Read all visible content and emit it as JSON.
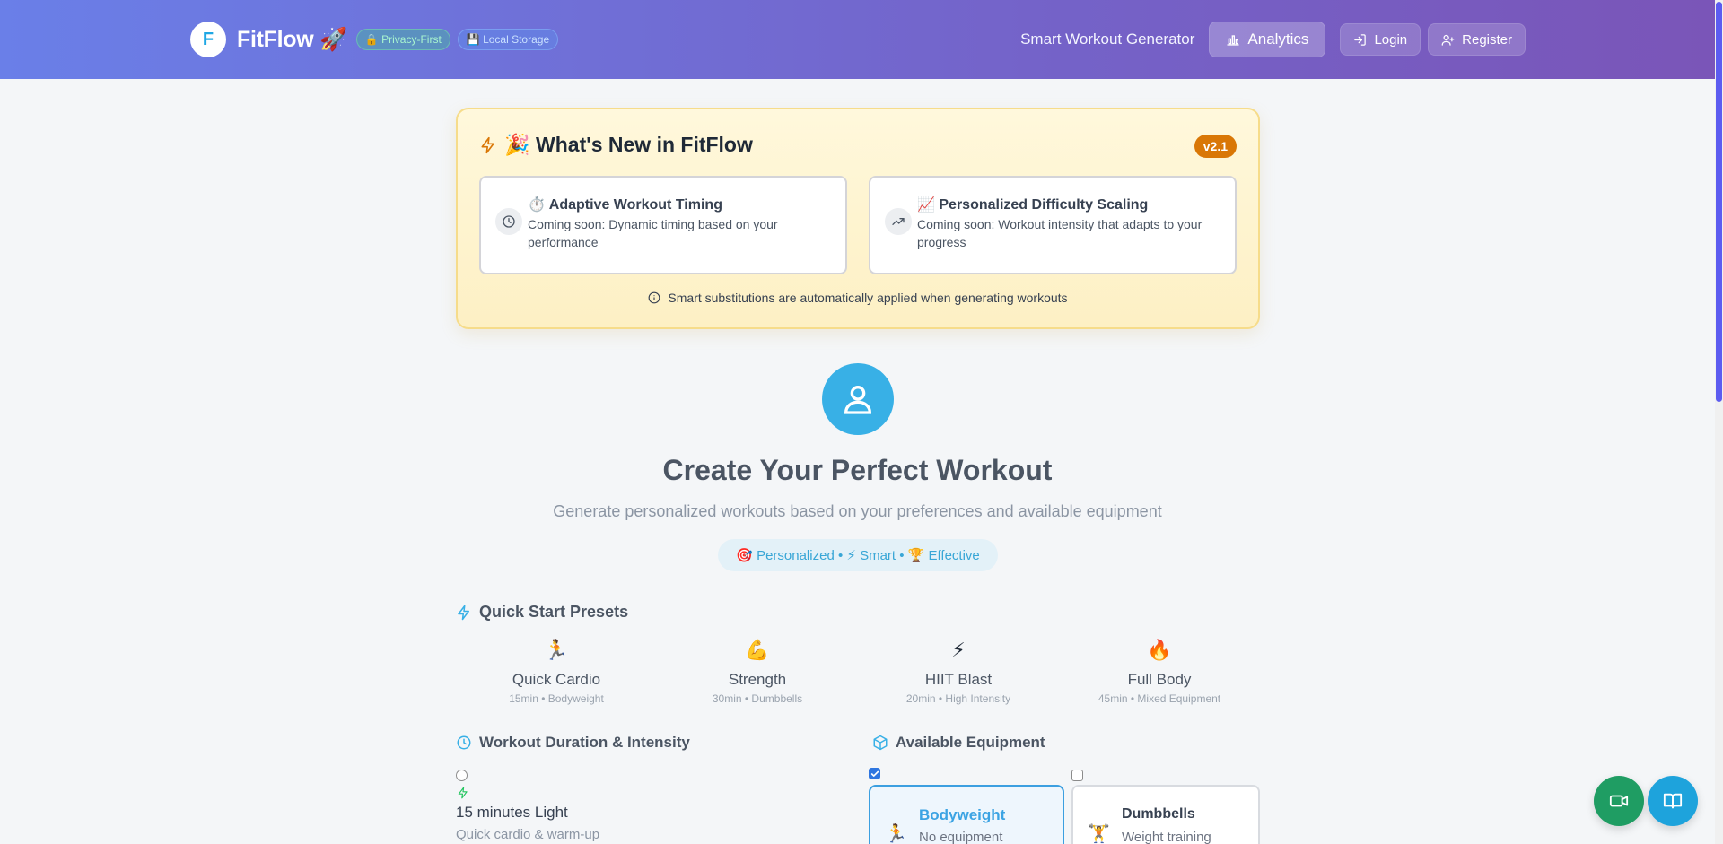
{
  "header": {
    "logo_letter": "F",
    "app_name": "FitFlow 🚀",
    "badges": [
      {
        "label": "🔒 Privacy-First"
      },
      {
        "label": "💾 Local Storage"
      }
    ],
    "nav_title": "Smart Workout Generator",
    "analytics_label": "Analytics",
    "login_label": "Login",
    "register_label": "Register"
  },
  "whats_new": {
    "title": "🎉 What's New in FitFlow",
    "version": "v2.1",
    "features": [
      {
        "title": "⏱️ Adaptive Workout Timing",
        "description": "Coming soon: Dynamic timing based on your performance",
        "icon": "clock-icon"
      },
      {
        "title": "📈 Personalized Difficulty Scaling",
        "description": "Coming soon: Workout intensity that adapts to your progress",
        "icon": "trending-up-icon"
      }
    ],
    "note": "Smart substitutions are automatically applied when generating workouts"
  },
  "hero": {
    "title": "Create Your Perfect Workout",
    "subtitle": "Generate personalized workouts based on your preferences and available equipment",
    "tags": "🎯 Personalized • ⚡ Smart • 🏆 Effective"
  },
  "presets": {
    "heading": "Quick Start Presets",
    "items": [
      {
        "icon": "🏃",
        "name": "Quick Cardio",
        "meta": "15min • Bodyweight"
      },
      {
        "icon": "💪",
        "name": "Strength",
        "meta": "30min • Dumbbells"
      },
      {
        "icon": "⚡",
        "name": "HIIT Blast",
        "meta": "20min • High Intensity"
      },
      {
        "icon": "🔥",
        "name": "Full Body",
        "meta": "45min • Mixed Equipment"
      }
    ]
  },
  "duration": {
    "heading": "Workout Duration & Intensity",
    "option_minutes": "15 minutes",
    "option_intensity": "Light",
    "option_desc": "Quick cardio & warm-up"
  },
  "equipment": {
    "heading": "Available Equipment",
    "items": [
      {
        "icon": "🏃",
        "name": "Bodyweight",
        "desc": "No equipment",
        "checked": true
      },
      {
        "icon": "🏋️",
        "name": "Dumbbells",
        "desc": "Weight training",
        "checked": false
      }
    ]
  },
  "colors": {
    "header_gradient_start": "#6a7fe8",
    "header_gradient_end": "#7a55b8",
    "accent": "#38b0e6",
    "version_badge": "#d97706"
  }
}
